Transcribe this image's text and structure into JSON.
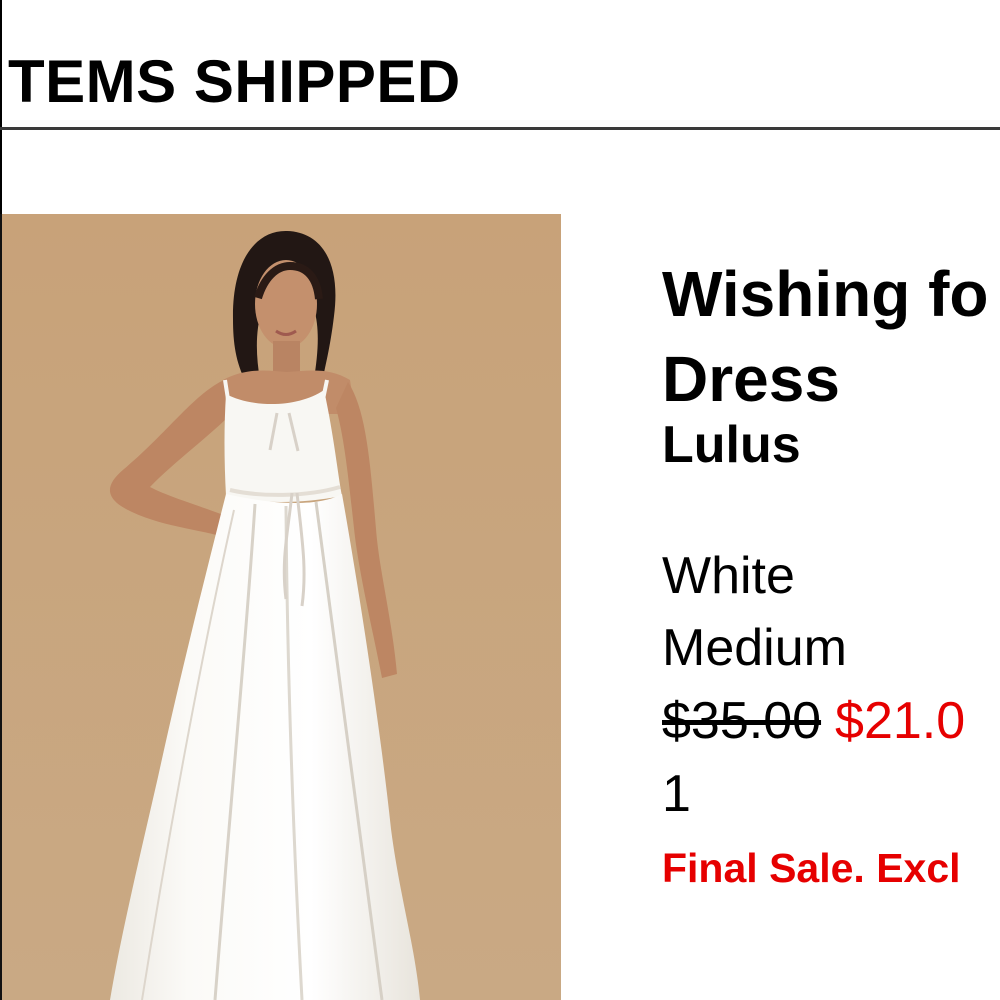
{
  "section": {
    "heading": "TEMS SHIPPED"
  },
  "product": {
    "image_description": "product-photo",
    "name_line1": "Wishing fo",
    "name_line2": "Dress",
    "brand": "Lulus",
    "color": "White",
    "size": "Medium",
    "original_price": "$35.00",
    "sale_price": "$21.0",
    "quantity": "1",
    "notice": "Final Sale. Excl",
    "colors": {
      "sale": "#e60000",
      "photo_background": "#c9a57f",
      "dress": "#f8f7f3"
    }
  }
}
